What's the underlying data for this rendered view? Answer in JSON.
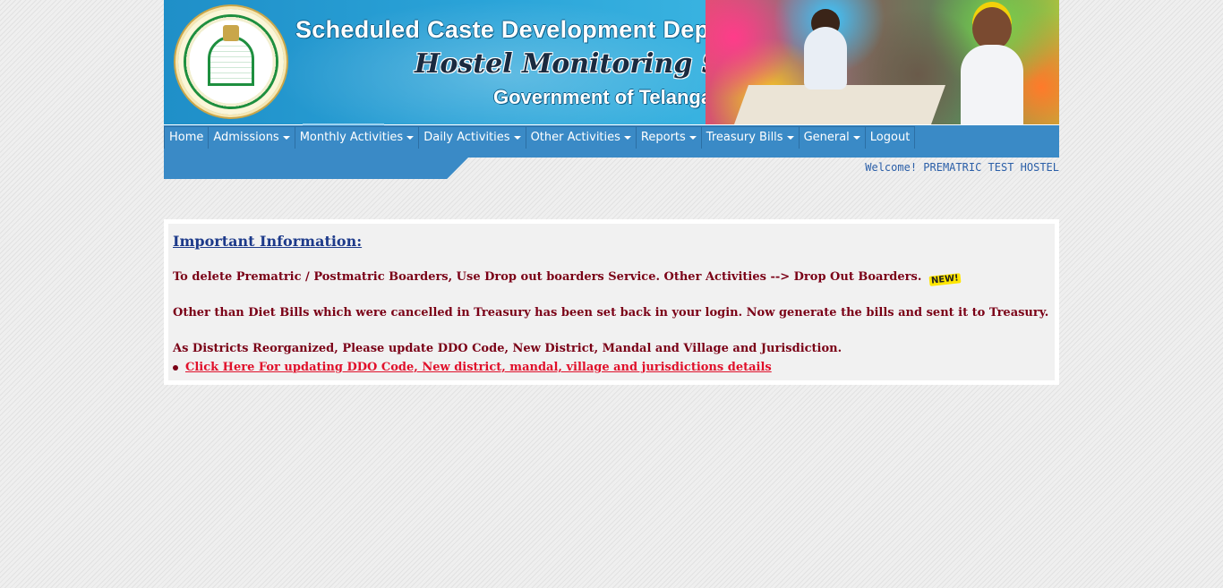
{
  "header": {
    "department": "Scheduled Caste Development Department",
    "system": "Hostel Monitoring System",
    "government": "Government of Telangana"
  },
  "nav": {
    "items": [
      {
        "label": "Home",
        "dropdown": false
      },
      {
        "label": "Admissions",
        "dropdown": true
      },
      {
        "label": "Monthly Activities",
        "dropdown": true
      },
      {
        "label": "Daily Activities",
        "dropdown": true
      },
      {
        "label": "Other Activities",
        "dropdown": true
      },
      {
        "label": "Reports",
        "dropdown": true
      },
      {
        "label": "Treasury Bills",
        "dropdown": true
      },
      {
        "label": "General",
        "dropdown": true
      },
      {
        "label": "Logout",
        "dropdown": false
      }
    ]
  },
  "welcome": "Welcome! PREMATRIC TEST HOSTEL",
  "info": {
    "heading": "Important Information:",
    "message1": "To delete Prematric / Postmatric Boarders, Use Drop out boarders Service. Other Activities --> Drop Out Boarders.",
    "new_badge": "NEW!",
    "message2": "Other than Diet Bills which were cancelled in Treasury has been set back in your login. Now generate the bills and sent it to Treasury.",
    "message3": "As Districts Reorganized, Please update DDO Code, New District, Mandal and Village and Jurisdiction.",
    "link": "Click Here For updating DDO Code, New district, mandal, village and jurisdictions details"
  },
  "colors": {
    "nav_blue": "#3a8ac6",
    "heading_blue": "#1d3a8a",
    "message_maroon": "#7a0016",
    "link_red": "#e0102a"
  }
}
